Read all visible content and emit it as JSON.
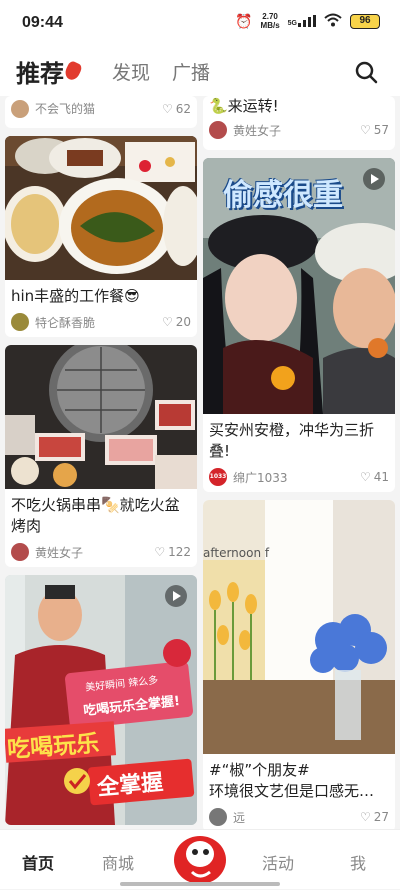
{
  "status_bar": {
    "time": "09:44",
    "speed": "2.70",
    "speed_unit": "MB/s",
    "network": "5G",
    "battery": "96"
  },
  "header": {
    "tabs": [
      "推荐",
      "发现",
      "广播"
    ]
  },
  "left_feed": [
    {
      "title": "",
      "user": "不会飞的猫",
      "likes": "62",
      "avatar_color": "#c9a07a"
    },
    {
      "title": "hin丰盛的工作餐😎",
      "user": "特仑酥香脆",
      "likes": "20",
      "avatar_color": "#9a8a3a"
    },
    {
      "title": "不吃火锅串串🍢就吃火盆烤肉",
      "user": "黄姓女子",
      "likes": "122",
      "avatar_color": "#b34c4c"
    },
    {
      "title": "",
      "overlay_top": "美好瞬间 辣么多",
      "overlay_mid": "吃喝玩乐全掌握!",
      "overlay_big1": "吃喝玩乐",
      "overlay_big2": "全掌握"
    }
  ],
  "right_feed": [
    {
      "title": "🐍来运转!",
      "user": "黄姓女子",
      "likes": "57",
      "avatar_color": "#b34c4c"
    },
    {
      "title": "买安州安橙，冲华为三折叠!",
      "image_caption": "偷感很重",
      "user": "绵广1033",
      "likes": "41",
      "avatar_color": "#d4242a",
      "avatar_text": "1033"
    },
    {
      "title": "#“椒”个朋友#\n环境很文艺但是口感无…",
      "image_caption": "afternoon f",
      "user": "远",
      "likes": "27",
      "avatar_color": "#777"
    }
  ],
  "bottom_nav": [
    "首页",
    "商城",
    "活动",
    "我"
  ],
  "colors": {
    "accent": "#e02424",
    "text": "#222222",
    "muted": "#888888"
  }
}
